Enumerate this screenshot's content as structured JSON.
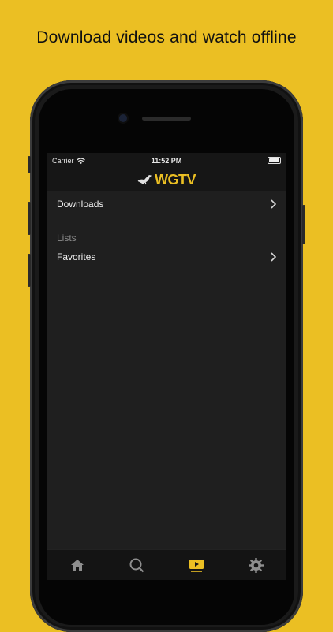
{
  "headline": "Download videos and watch offline",
  "status_bar": {
    "carrier": "Carrier",
    "time": "11:52 PM"
  },
  "nav": {
    "logo_text": "WGTV"
  },
  "menu": {
    "downloads_label": "Downloads",
    "lists_section_label": "Lists",
    "favorites_label": "Favorites"
  },
  "tabbar": {
    "tabs": [
      {
        "icon": "home-icon",
        "active": false
      },
      {
        "icon": "search-icon",
        "active": false
      },
      {
        "icon": "video-play-icon",
        "active": true
      },
      {
        "icon": "gear-icon",
        "active": false
      }
    ]
  },
  "colors": {
    "brand_yellow": "#ebbf23",
    "screen_bg": "#1f1f1f",
    "inactive_icon": "#8e8e8e"
  }
}
